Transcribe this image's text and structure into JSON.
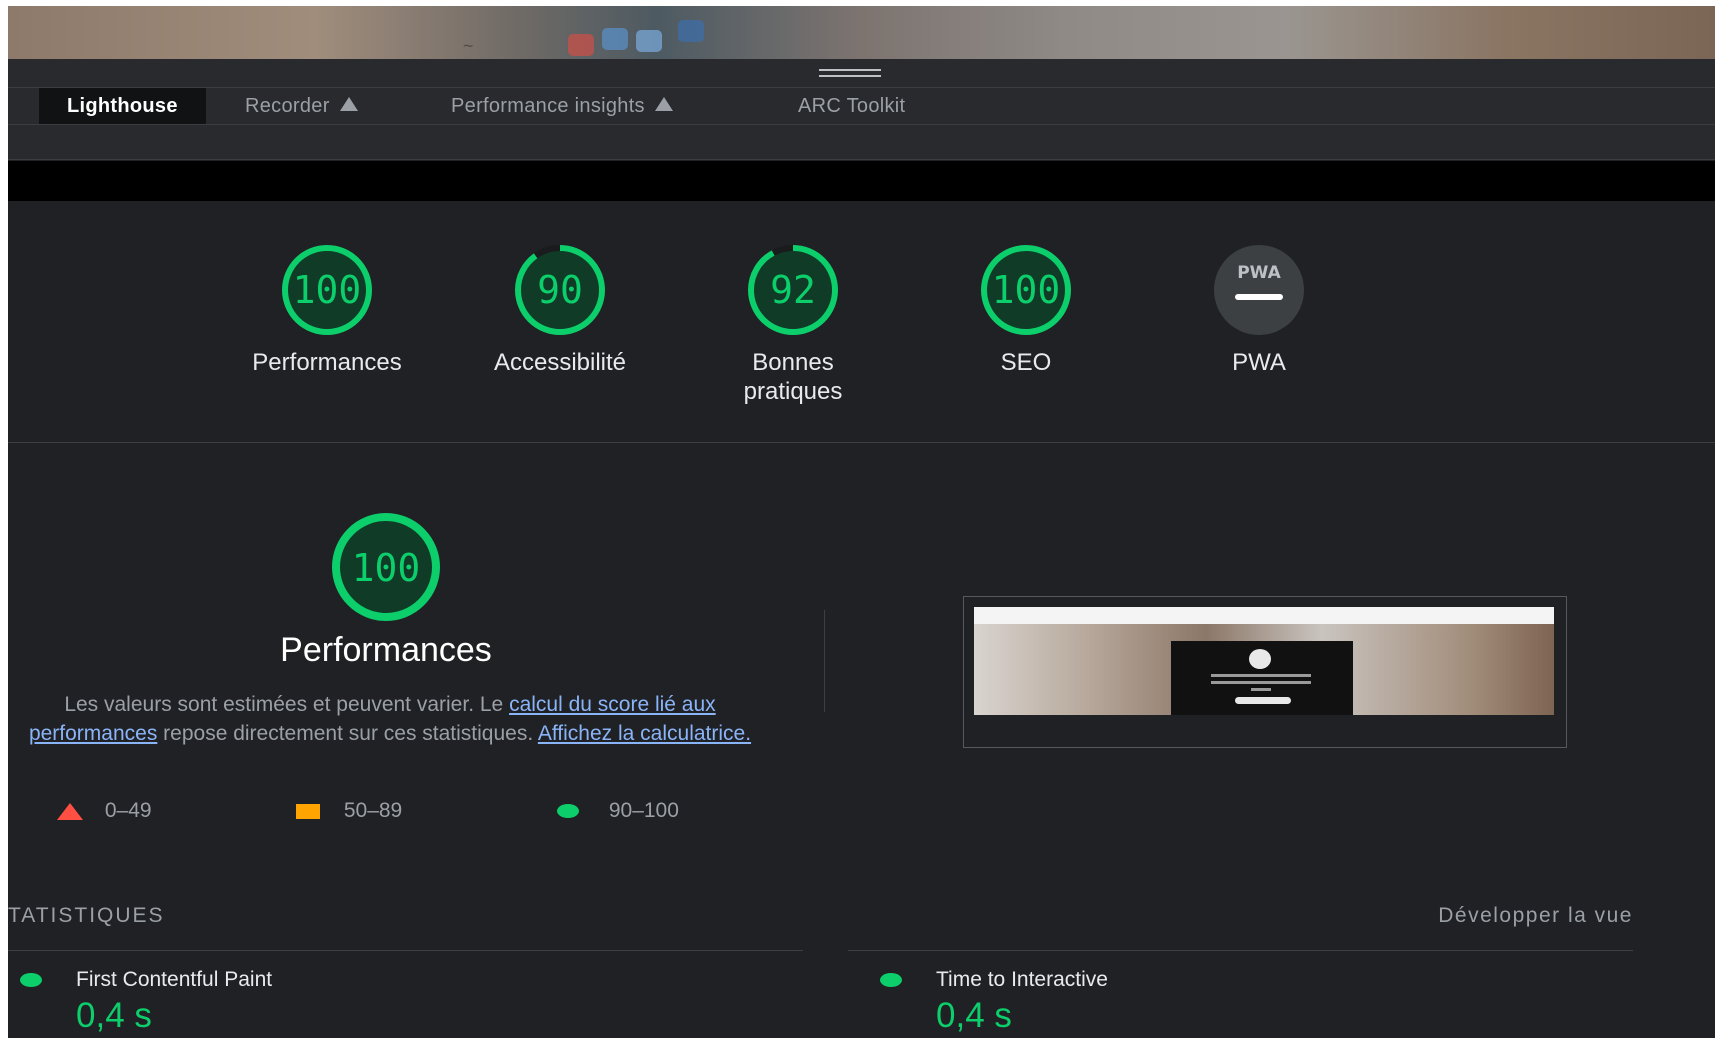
{
  "tabs": [
    {
      "label": "Lighthouse",
      "active": true,
      "icon": null
    },
    {
      "label": "Recorder",
      "active": false,
      "icon": "flask-icon"
    },
    {
      "label": "Performance insights",
      "active": false,
      "icon": "flask-icon"
    },
    {
      "label": "ARC Toolkit",
      "active": false,
      "icon": null
    }
  ],
  "gauges": [
    {
      "score": "100",
      "label": "Performances"
    },
    {
      "score": "90",
      "label": "Accessibilité"
    },
    {
      "score": "92",
      "label": "Bonnes pratiques"
    },
    {
      "score": "100",
      "label": "SEO"
    },
    {
      "score": "",
      "label": "PWA",
      "badge": "PWA"
    }
  ],
  "performance": {
    "score": "100",
    "title": "Performances",
    "desc_before": "Les valeurs sont estimées et peuvent varier. Le ",
    "desc_link": "calcul du score lié aux performances",
    "desc_middle": " repose directement sur ces statistiques. ",
    "calc_link": "Affichez la calculatrice."
  },
  "legend": [
    {
      "shape": "triangle",
      "range": "0–49",
      "color": "#ff4e42"
    },
    {
      "shape": "square",
      "range": "50–89",
      "color": "#ffa400"
    },
    {
      "shape": "circle",
      "range": "90–100",
      "color": "#0cce6b"
    }
  ],
  "stats": {
    "heading": "TATISTIQUES",
    "expand": "Développer la vue",
    "metrics": [
      {
        "name": "First Contentful Paint",
        "value": "0,4 s"
      },
      {
        "name": "Time to Interactive",
        "value": "0,4 s"
      }
    ]
  },
  "colors": {
    "pass": "#0cce6b",
    "average": "#ffa400",
    "fail": "#ff4e42",
    "background": "#202124"
  }
}
